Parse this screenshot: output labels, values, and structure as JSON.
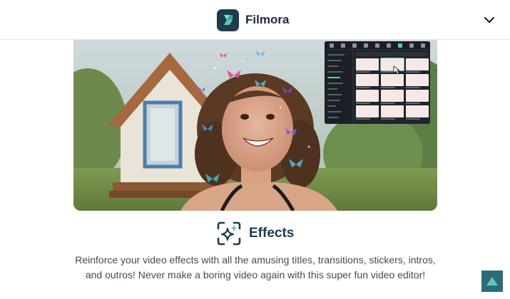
{
  "header": {
    "brand_name": "Filmora",
    "logo_icon": "filmora-logo-icon",
    "menu_icon": "chevron-down-icon"
  },
  "hero": {
    "description": "video editor screenshot",
    "effects_panel_icon": "effects-panel-preview"
  },
  "feature": {
    "icon": "effects-sparkle-icon",
    "heading": "Effects",
    "description": "Reinforce your video effects with all the amusing titles, transitions, stickers, intros, and outros! Never make a boring video again with this super fun video editor!"
  },
  "back_to_top": {
    "icon": "arrow-up-icon"
  },
  "colors": {
    "brand_dark": "#1f3b4d",
    "accent_teal": "#5ec9b4",
    "back_to_top_bg": "#2a6b7c"
  }
}
